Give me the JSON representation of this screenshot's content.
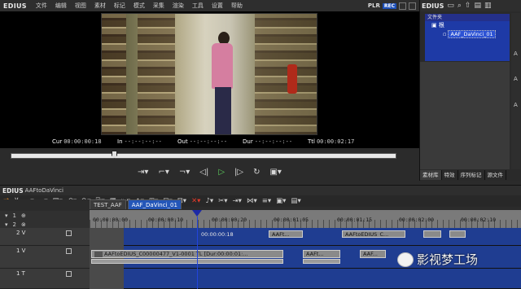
{
  "app": {
    "name": "EDIUS"
  },
  "menu": [
    "文件",
    "编辑",
    "视图",
    "素材",
    "标记",
    "模式",
    "采集",
    "渲染",
    "工具",
    "设置",
    "帮助"
  ],
  "player": {
    "mode_plr": "PLR",
    "mode_rec": "REC",
    "timecodes": {
      "cur_label": "Cur",
      "cur": "00:00:00:18",
      "in_label": "In",
      "in": "--:--:--:--",
      "out_label": "Out",
      "out": "--:--:--:--",
      "dur_label": "Dur",
      "dur": "--:--:--:--",
      "ttl_label": "Ttl",
      "ttl": "00:00:02:17"
    }
  },
  "bin": {
    "app_name": "EDIUS",
    "folder_header": "文件夹",
    "root_label": "根",
    "child_label": "AAF_DaVinci_01",
    "peek_letters": [
      "A",
      "A",
      "A"
    ],
    "tabs": [
      "素材库",
      "特效",
      "序列标记",
      "源文件"
    ]
  },
  "timeline": {
    "app_name": "EDIUS",
    "sequence_name": "AAFtoDaVinci",
    "seq_tabs": [
      "TEST_AAF",
      "AAF_DaVinci_01"
    ],
    "ctrl_values": [
      "1",
      "2"
    ],
    "ruler": [
      "00:00:00:00",
      "00:00:00:10",
      "00:00:00:20",
      "00:00:01:05",
      "00:00:01:15",
      "00:00:02:00",
      "00:00:02:10"
    ],
    "tracks": [
      {
        "name": "2 V"
      },
      {
        "name": "1 V"
      },
      {
        "name": "1 T"
      }
    ],
    "clips": {
      "tc_label": "00:00:00:18",
      "v2_a": "AAFt...",
      "v2_b": "AAFtoEDIUS_C...",
      "v1_main": "AAFtoEDIUS_C00000477_V1-0001  TL [Dur:00:00:01:...",
      "v1_b": "AAFt...",
      "v1_c": "AAF..."
    }
  },
  "watermark": {
    "text": "影视梦工场"
  }
}
